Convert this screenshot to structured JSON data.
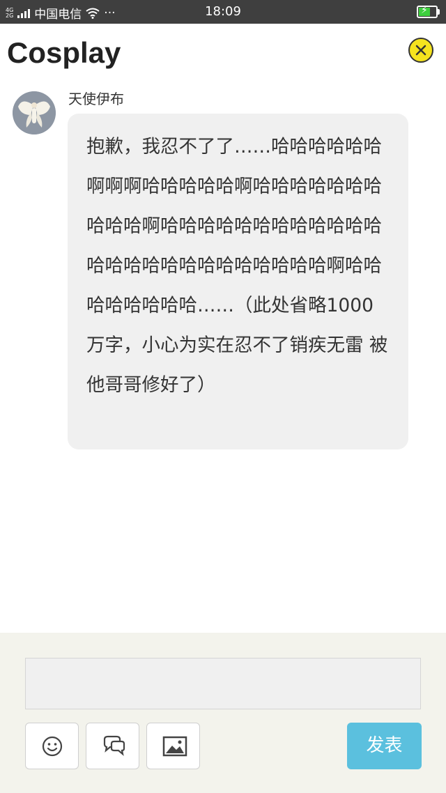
{
  "status_bar": {
    "network_top": "4G",
    "network_bottom": "2G",
    "carrier": "中国电信",
    "more": "···",
    "time": "18:09"
  },
  "header": {
    "title": "Cosplay"
  },
  "message": {
    "username": "天使伊布",
    "text": "抱歉，我忍不了了……哈哈哈哈哈哈啊啊啊哈哈哈哈哈啊哈哈哈哈哈哈哈哈哈哈啊哈哈哈哈哈哈哈哈哈哈哈哈哈哈哈哈哈哈哈哈哈哈哈哈哈啊哈哈哈哈哈哈哈哈……（此处省略1000万字，小心为实在忍不了销疾无雷 被他哥哥修好了）"
  },
  "composer": {
    "input_value": "",
    "send_label": "发表"
  },
  "colors": {
    "status_bar": "#3f3f3f",
    "close_button": "#f5e31e",
    "send_button": "#5bc0de",
    "bubble": "#f0f0f0",
    "composer_bg": "#f3f3ec"
  },
  "icons": {
    "close": "close-icon",
    "emoji": "smiley-icon",
    "comment": "chat-bubbles-icon",
    "image": "image-icon"
  }
}
